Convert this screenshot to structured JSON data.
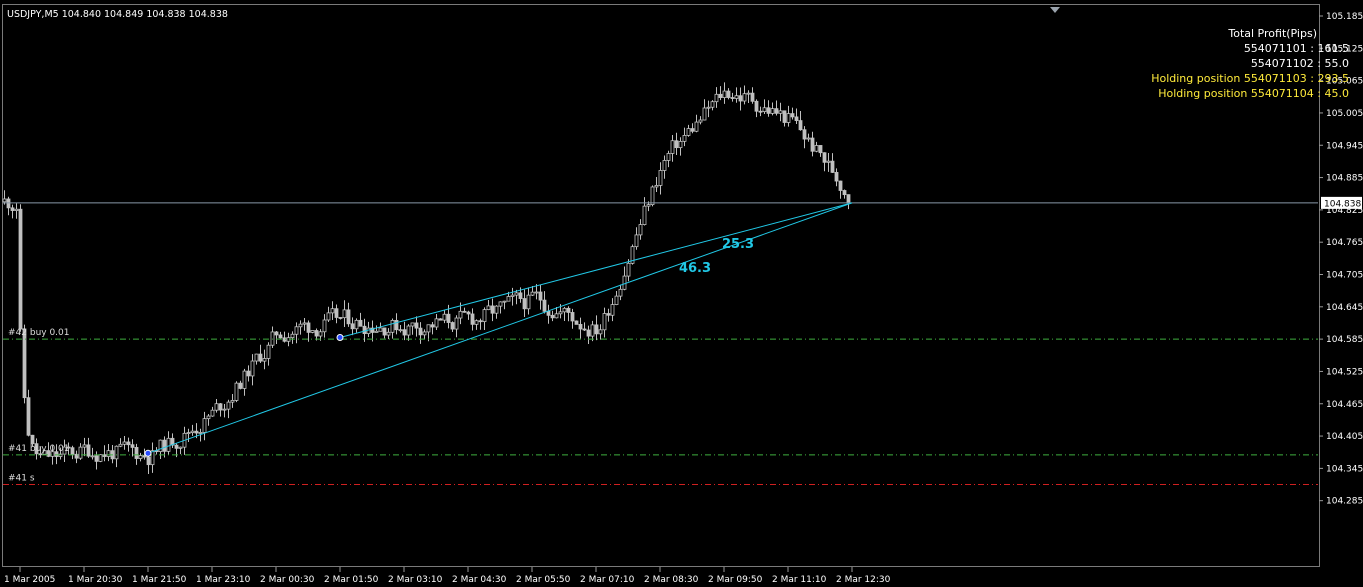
{
  "symbol_header": "USDJPY,M5  104.840 104.849 104.838 104.838",
  "chart_data": {
    "type": "candlestick",
    "symbol": "USDJPY",
    "timeframe": "M5",
    "ohlc_header": {
      "open": 104.84,
      "high": 104.849,
      "low": 104.838,
      "close": 104.838
    },
    "current_price": 104.838,
    "current_price_label": "104.838",
    "ylim": [
      104.225,
      105.185
    ],
    "yticks": [
      "105.185",
      "105.125",
      "105.065",
      "105.005",
      "104.945",
      "104.885",
      "104.825",
      "104.765",
      "104.705",
      "104.645",
      "104.585",
      "104.525",
      "104.465",
      "104.405",
      "104.345",
      "104.285"
    ],
    "xticks": [
      "1 Mar 2005",
      "1 Mar 20:30",
      "1 Mar 21:50",
      "1 Mar 23:10",
      "2 Mar 00:30",
      "2 Mar 01:50",
      "2 Mar 03:10",
      "2 Mar 04:30",
      "2 Mar 05:50",
      "2 Mar 07:10",
      "2 Mar 08:30",
      "2 Mar 09:50",
      "2 Mar 11:10",
      "2 Mar 12:30"
    ],
    "price_path": [
      [
        "1 Mar 2005",
        104.35
      ],
      [
        "1 Mar 20:30",
        104.38
      ],
      [
        "1 Mar 21:50",
        104.37
      ],
      [
        "1 Mar 23:10",
        104.45
      ],
      [
        "2 Mar 00:30",
        104.6
      ],
      [
        "2 Mar 01:50",
        104.62
      ],
      [
        "2 Mar 03:10",
        104.61
      ],
      [
        "2 Mar 04:30",
        104.62
      ],
      [
        "2 Mar 05:50",
        104.66
      ],
      [
        "2 Mar 07:10",
        104.6
      ],
      [
        "2 Mar 08:30",
        104.92
      ],
      [
        "2 Mar 09:50",
        105.05
      ],
      [
        "2 Mar 11:10",
        104.99
      ],
      [
        "2 Mar 12:30",
        104.84
      ]
    ],
    "level_lines": [
      {
        "label": "#42 buy 0.01",
        "price": 104.585,
        "color": "#3fae3f"
      },
      {
        "label": "#41 buy 0.01",
        "price": 104.37,
        "color": "#3fae3f"
      },
      {
        "label": "#41 s",
        "price": 104.315,
        "color": "#d02020"
      }
    ],
    "trend_lines": [
      {
        "from": [
          "1 Mar 21:50",
          104.373
        ],
        "to": [
          "2 Mar 12:30",
          104.838
        ],
        "label": "46.3"
      },
      {
        "from": [
          "2 Mar 01:50",
          104.588
        ],
        "to": [
          "2 Mar 12:30",
          104.838
        ],
        "label": "25.3"
      }
    ],
    "colors": {
      "candle": "#c0c0c0",
      "grid_line": "#8898a8",
      "trendline": "#21c8e6",
      "buy_level": "#3fae3f",
      "stop_level": "#d02020",
      "profit_text": "#ffffff",
      "holding_text": "#ffeb3b"
    }
  },
  "profit_panel": {
    "title": "Total Profit(Pips)",
    "rows": [
      {
        "text": "554071101 : 161.5",
        "color": "#ffffff"
      },
      {
        "text": "554071102 : 55.0",
        "color": "#ffffff"
      },
      {
        "text": "Holding position 554071103 : 293.5",
        "color": "#ffeb3b"
      },
      {
        "text": "Holding position 554071104 : 45.0",
        "color": "#ffeb3b"
      }
    ]
  }
}
